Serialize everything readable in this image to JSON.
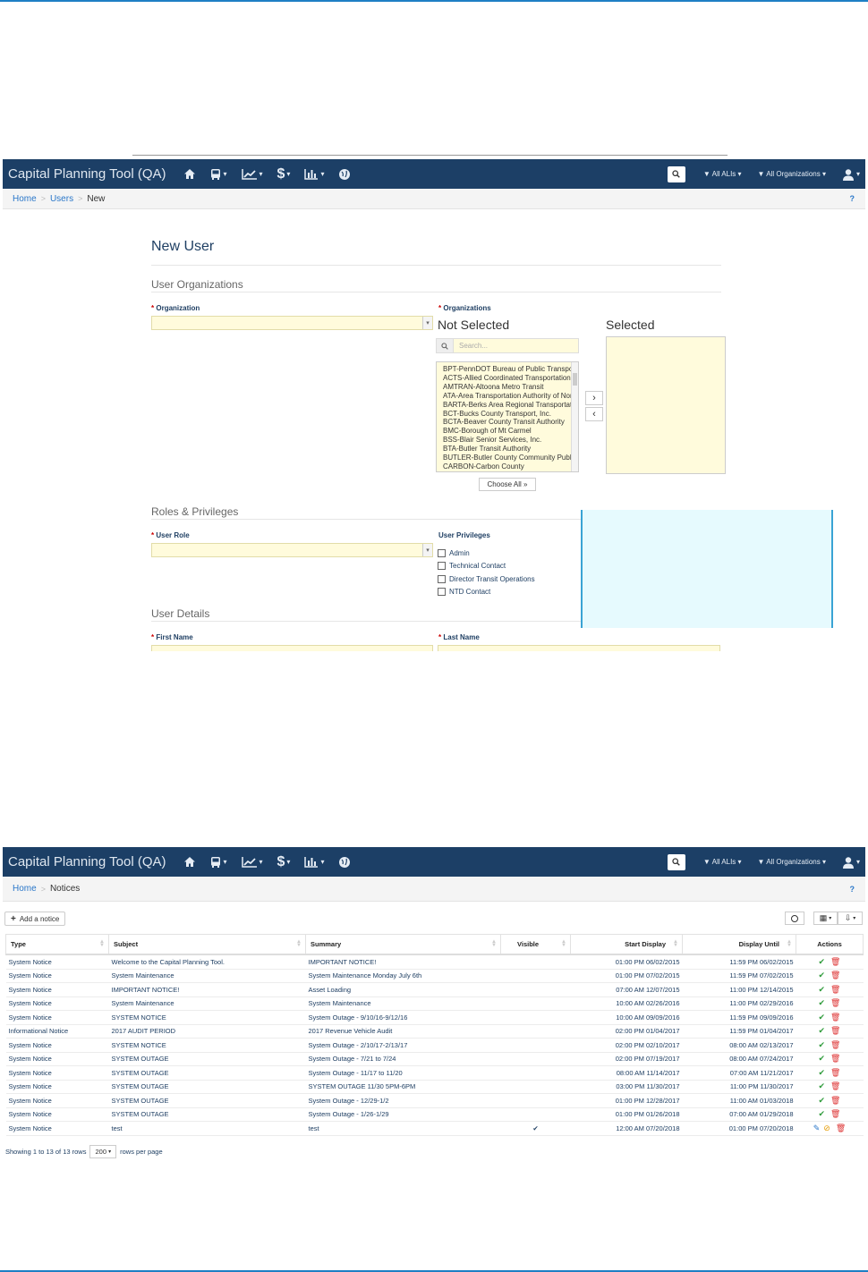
{
  "colors": {
    "navbar": "#1c3f66",
    "link": "#2a77c9",
    "field_fill": "#fffbdc",
    "info_panel": "#e6fafe",
    "accent": "#1e7fc4"
  },
  "app": {
    "title": "Capital Planning Tool (QA)",
    "filter_alis": "All ALIs",
    "filter_orgs": "All Organizations",
    "nav_icons": [
      "home-icon",
      "bus-icon",
      "line-chart-icon",
      "dollar-icon",
      "bar-chart-icon",
      "globe-icon",
      "search-icon",
      "filter-icon",
      "user-icon"
    ]
  },
  "new_user": {
    "breadcrumb": {
      "home": "Home",
      "users": "Users",
      "current": "New",
      "help": "?"
    },
    "title": "New User",
    "sec_orgs": "User Organizations",
    "label_organization": "Organization",
    "label_organizations": "Organizations",
    "not_selected": "Not Selected",
    "selected": "Selected",
    "search_placeholder": "Search...",
    "org_options": [
      "BPT-PennDOT Bureau of Public Transportation",
      "ACTS-Allied Coordinated Transportation Services",
      "AMTRAN-Altoona Metro Transit",
      "ATA-Area Transportation Authority of North Central PA",
      "BARTA-Berks Area Regional Transportation Authority",
      "BCT-Bucks County Transport, Inc.",
      "BCTA-Beaver County Transit Authority",
      "BMC-Borough of Mt Carmel",
      "BSS-Blair Senior Services, Inc.",
      "BTA-Butler Transit Authority",
      "BUTLER-Butler County Community Public",
      "CARBON-Carbon County"
    ],
    "choose_all": "Choose All »",
    "sec_roles": "Roles & Privileges",
    "label_user_role": "User Role",
    "label_privileges": "User Privileges",
    "privileges": [
      "Admin",
      "Technical Contact",
      "Director Transit Operations",
      "NTD Contact"
    ],
    "sec_details": "User Details",
    "label_first": "First Name",
    "label_last": "Last Name",
    "req": "*"
  },
  "notices": {
    "breadcrumb": {
      "home": "Home",
      "current": "Notices",
      "help": "?"
    },
    "add_label": "Add a notice",
    "columns": [
      "Type",
      "Subject",
      "Summary",
      "Visible",
      "Start Display",
      "Display Until",
      "Actions"
    ],
    "rows": [
      {
        "type": "System Notice",
        "subject": "Welcome to the Capital Planning Tool.",
        "summary": "IMPORTANT NOTICE!",
        "visible": "",
        "start": "01:00 PM 06/02/2015",
        "until": "11:59 PM 06/02/2015"
      },
      {
        "type": "System Notice",
        "subject": "System Maintenance",
        "summary": "System Maintenance Monday July 6th",
        "visible": "",
        "start": "01:00 PM 07/02/2015",
        "until": "11:59 PM 07/02/2015"
      },
      {
        "type": "System Notice",
        "subject": "IMPORTANT NOTICE!",
        "summary": "Asset Loading",
        "visible": "",
        "start": "07:00 AM 12/07/2015",
        "until": "11:00 PM 12/14/2015"
      },
      {
        "type": "System Notice",
        "subject": "System Maintenance",
        "summary": "System Maintenance",
        "visible": "",
        "start": "10:00 AM 02/26/2016",
        "until": "11:00 PM 02/29/2016"
      },
      {
        "type": "System Notice",
        "subject": "SYSTEM NOTICE",
        "summary": "System Outage - 9/10/16-9/12/16",
        "visible": "",
        "start": "10:00 AM 09/09/2016",
        "until": "11:59 PM 09/09/2016"
      },
      {
        "type": "Informational Notice",
        "subject": "2017 AUDIT PERIOD",
        "summary": "2017 Revenue Vehicle Audit",
        "visible": "",
        "start": "02:00 PM 01/04/2017",
        "until": "11:59 PM 01/04/2017"
      },
      {
        "type": "System Notice",
        "subject": "SYSTEM NOTICE",
        "summary": "System Outage - 2/10/17-2/13/17",
        "visible": "",
        "start": "02:00 PM 02/10/2017",
        "until": "08:00 AM 02/13/2017"
      },
      {
        "type": "System Notice",
        "subject": "SYSTEM OUTAGE",
        "summary": "System Outage - 7/21 to 7/24",
        "visible": "",
        "start": "02:00 PM 07/19/2017",
        "until": "08:00 AM 07/24/2017"
      },
      {
        "type": "System Notice",
        "subject": "SYSTEM OUTAGE",
        "summary": "System Outage - 11/17 to 11/20",
        "visible": "",
        "start": "08:00 AM 11/14/2017",
        "until": "07:00 AM 11/21/2017"
      },
      {
        "type": "System Notice",
        "subject": "SYSTEM OUTAGE",
        "summary": "SYSTEM OUTAGE 11/30 5PM-6PM",
        "visible": "",
        "start": "03:00 PM 11/30/2017",
        "until": "11:00 PM 11/30/2017"
      },
      {
        "type": "System Notice",
        "subject": "SYSTEM OUTAGE",
        "summary": "System Outage - 12/29-1/2",
        "visible": "",
        "start": "01:00 PM 12/28/2017",
        "until": "11:00 AM 01/03/2018"
      },
      {
        "type": "System Notice",
        "subject": "SYSTEM OUTAGE",
        "summary": "System Outage - 1/26-1/29",
        "visible": "",
        "start": "01:00 PM 01/26/2018",
        "until": "07:00 AM 01/29/2018"
      },
      {
        "type": "System Notice",
        "subject": "test",
        "summary": "test",
        "visible": "✔",
        "start": "12:00 AM 07/20/2018",
        "until": "01:00 PM 07/20/2018"
      }
    ],
    "footer_prefix": "Showing 1 to 13 of 13 rows",
    "per_page": "200",
    "footer_suffix": "rows per page"
  }
}
